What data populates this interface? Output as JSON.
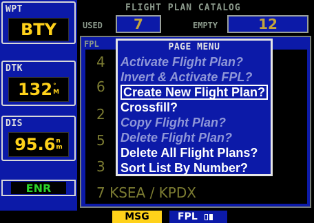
{
  "fields": {
    "wpt": {
      "label": "WPT",
      "value": "BTY"
    },
    "dtk": {
      "label": "DTK",
      "value": "132",
      "unit_top": "°",
      "unit_bottom": "M"
    },
    "dis": {
      "label": "DIS",
      "value": "95.6",
      "unit_top": "n",
      "unit_bottom": "m"
    },
    "mode": "ENR"
  },
  "catalog": {
    "title": "FLIGHT PLAN CATALOG",
    "used_label": "USED",
    "used_value": "7",
    "empty_label": "EMPTY",
    "empty_value": "12",
    "list_header": "FPL",
    "items": [
      {
        "number": "4"
      },
      {
        "number": "6"
      },
      {
        "number": "2"
      },
      {
        "number": "5"
      },
      {
        "number": "3"
      },
      {
        "number": "7",
        "route": "KSEA / KPDX"
      }
    ]
  },
  "page_menu": {
    "title": "PAGE MENU",
    "items": [
      {
        "label": "Activate Flight Plan?",
        "state": "disabled"
      },
      {
        "label": "Invert & Activate FPL?",
        "state": "disabled"
      },
      {
        "label": "Create New Flight Plan?",
        "state": "selected"
      },
      {
        "label": "Crossfill?",
        "state": "enabled"
      },
      {
        "label": "Copy Flight Plan?",
        "state": "disabled"
      },
      {
        "label": "Delete Flight Plan?",
        "state": "disabled"
      },
      {
        "label": "Delete All Flight Plans?",
        "state": "enabled"
      },
      {
        "label": "Sort List By Number?",
        "state": "enabled"
      }
    ]
  },
  "status_bar": {
    "msg": "MSG",
    "page_group": "FPL",
    "page_count": 2,
    "current_page": 2
  },
  "colors": {
    "field_blue": "#0c1aa8",
    "value_yellow": "#ffd21a",
    "mode_green": "#2bd42b"
  }
}
